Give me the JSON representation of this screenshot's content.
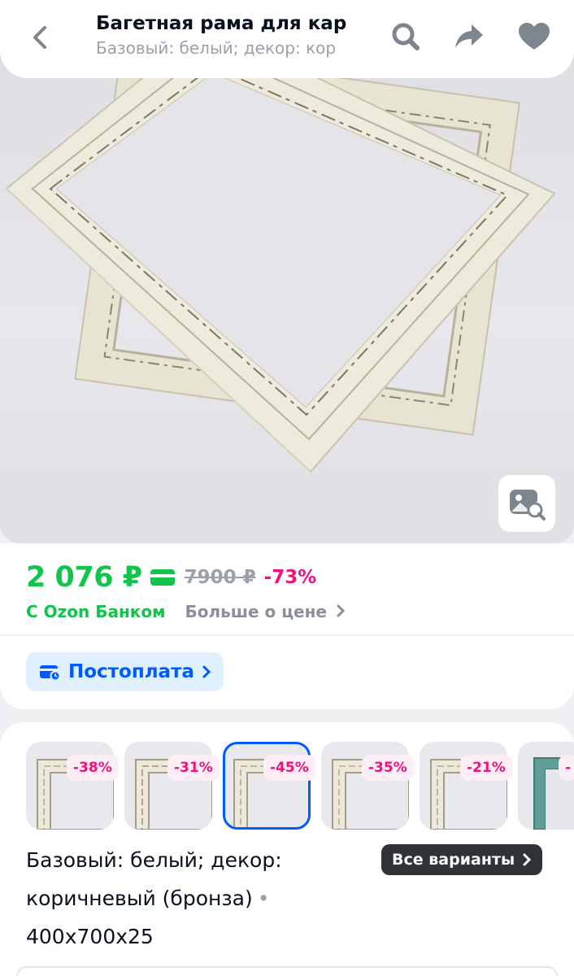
{
  "header": {
    "title": "Багетная рама для кар",
    "subtitle": "Базовый: белый; декор: кор"
  },
  "icons": [
    "back-arrow-icon",
    "search-icon",
    "share-icon",
    "heart-icon",
    "image-search-icon",
    "bank-card-icon",
    "postpay-icon",
    "chevron-right-icon"
  ],
  "price": {
    "current": "2 076 ₽",
    "old": "7900 ₽",
    "discount": "-73%",
    "bank_label": "С Ozon Банком",
    "more_label": "Больше о цене"
  },
  "postpay": {
    "label": "Постоплата"
  },
  "variants": {
    "badges": [
      "-38%",
      "-31%",
      "-45%",
      "-35%",
      "-21%",
      "-"
    ],
    "selected_index": 2,
    "description_lines": [
      "Базовый: белый; декор:",
      "коричневый (бронза)",
      "400x700x25"
    ],
    "all_label": "Все варианты"
  },
  "colors": {
    "price_green": "#10c44c",
    "discount_pink": "#f1117e",
    "ozon_blue": "#005bff"
  }
}
